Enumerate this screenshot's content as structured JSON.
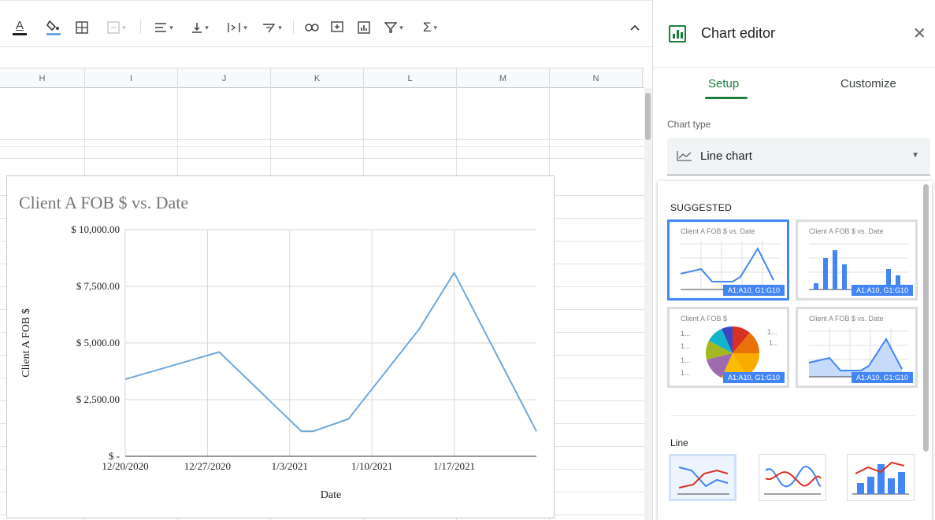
{
  "toolbar": {
    "icons": [
      "text-color-icon",
      "fill-color-icon",
      "borders-icon",
      "merge-cells-icon",
      "horizontal-align-icon",
      "vertical-align-icon",
      "text-wrap-icon",
      "text-rotation-icon",
      "insert-link-icon",
      "insert-comment-icon",
      "insert-chart-icon",
      "filter-icon",
      "functions-icon",
      "collapse-toolbar-icon"
    ],
    "text_color_letter": "A",
    "sigma": "Σ"
  },
  "columns": [
    "H",
    "I",
    "J",
    "K",
    "L",
    "M",
    "N"
  ],
  "chart": {
    "title": "Client A FOB $ vs. Date",
    "xlabel": "Date",
    "ylabel": "Client A FOB $",
    "line_color": "#6fa8dc"
  },
  "chart_data": {
    "type": "line",
    "title": "Client A FOB $ vs. Date",
    "xlabel": "Date",
    "ylabel": "Client A FOB $",
    "x_tick_labels": [
      "12/20/2020",
      "12/27/2020",
      "1/3/2021",
      "1/10/2021",
      "1/17/2021"
    ],
    "y_tick_labels": [
      "$ -",
      "$ 2,500.00",
      "$ 5,000.00",
      "$ 7,500.00",
      "$ 10,000.00"
    ],
    "ylim": [
      0,
      10000
    ],
    "xlim": [
      "2020-12-20",
      "2021-01-24"
    ],
    "grid": true,
    "series": [
      {
        "x": [
          "2020-12-20",
          "2020-12-28",
          "2021-01-04",
          "2021-01-05",
          "2021-01-08",
          "2021-01-14",
          "2021-01-17",
          "2021-01-24"
        ],
        "y": [
          3400,
          4600,
          1100,
          1100,
          1650,
          5600,
          8100,
          1100
        ]
      }
    ]
  },
  "panel": {
    "title": "Chart editor",
    "close": "✕",
    "tabs": [
      "Setup",
      "Customize"
    ],
    "chart_type_label": "Chart type",
    "chart_type_value": "Line chart",
    "suggested_label": "SUGGESTED",
    "suggestions": [
      {
        "title": "Client A FOB $ vs. Date",
        "range": "A1:A10, G1:G10",
        "kind": "line",
        "selected": true
      },
      {
        "title": "Client A FOB $ vs. Date",
        "range": "A1:A10, G1:G10",
        "kind": "column",
        "selected": false
      },
      {
        "title": "Client A FOB $",
        "range": "A1:A10, G1:G10",
        "kind": "pie",
        "selected": false
      },
      {
        "title": "Client A FOB $ vs. Date",
        "range": "A1:A10, G1:G10",
        "kind": "area",
        "selected": false
      }
    ],
    "line_section_label": "Line",
    "line_options": [
      "line-chart-option",
      "smooth-line-chart-option",
      "combo-chart-option"
    ]
  }
}
